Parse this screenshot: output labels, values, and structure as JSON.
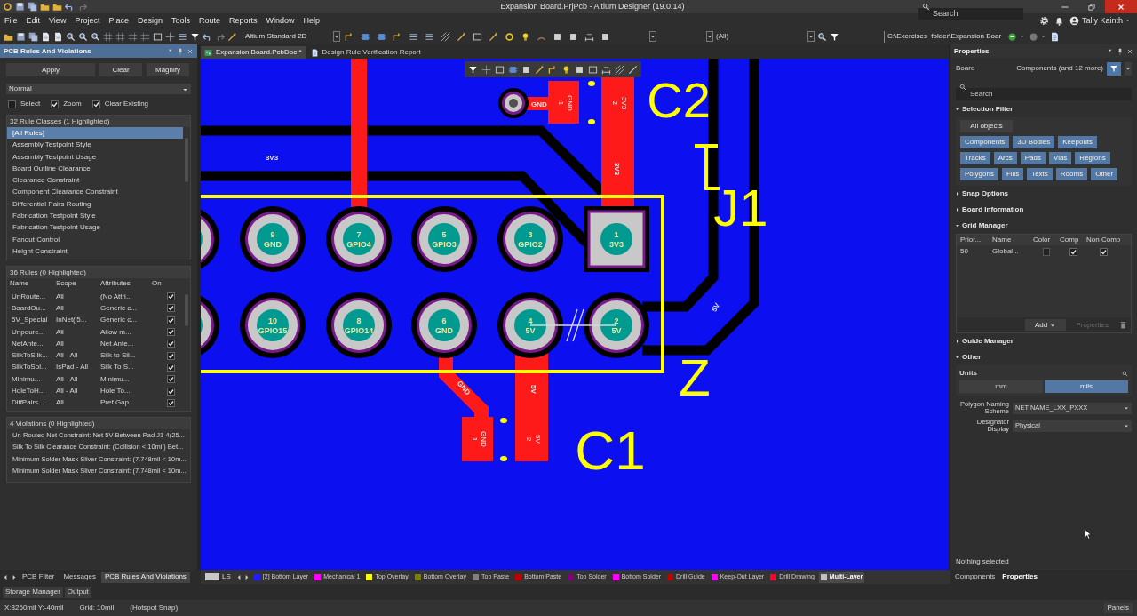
{
  "title_bar": {
    "title": "Expansion Board.PrjPcb - Altium Designer (19.0.14)",
    "search_placeholder": "Search"
  },
  "menu": [
    "File",
    "Edit",
    "View",
    "Project",
    "Place",
    "Design",
    "Tools",
    "Route",
    "Reports",
    "Window",
    "Help"
  ],
  "user": {
    "name": "Tally Kainth"
  },
  "toolbar": {
    "view_mode": "Altium Standard 2D",
    "filter": "(All)",
    "path": "C:\\Exercises  folder\\Expansion Boar"
  },
  "left_panel": {
    "title": "PCB Rules And Violations",
    "buttons": [
      "Apply",
      "Clear",
      "Magnify"
    ],
    "mode": "Normal",
    "options": [
      {
        "label": "Select",
        "checked": false
      },
      {
        "label": "Zoom",
        "checked": true
      },
      {
        "label": "Clear Existing",
        "checked": true
      }
    ],
    "rule_classes": {
      "header": "32 Rule Classes (1 Highlighted)",
      "items": [
        {
          "label": "[All Rules]",
          "selected": true
        },
        {
          "label": "Assembly Testpoint Style",
          "selected": false
        },
        {
          "label": "Assembly Testpoint Usage",
          "selected": false
        },
        {
          "label": "Board Outline Clearance",
          "selected": false
        },
        {
          "label": "Clearance Constraint",
          "selected": false
        },
        {
          "label": "Component Clearance Constraint",
          "selected": false
        },
        {
          "label": "Differential Pairs Routing",
          "selected": false
        },
        {
          "label": "Fabrication Testpoint Style",
          "selected": false
        },
        {
          "label": "Fabrication Testpoint Usage",
          "selected": false
        },
        {
          "label": "Fanout Control",
          "selected": false
        },
        {
          "label": "Height Constraint",
          "selected": false
        }
      ]
    },
    "rules": {
      "header": "36 Rules (0 Highlighted)",
      "columns": [
        "Name",
        "Scope",
        "Attributes",
        "On"
      ],
      "rows": [
        {
          "name": "UnRoute...",
          "scope": "All",
          "attributes": "(No Attri...",
          "on": true
        },
        {
          "name": "BoardOu...",
          "scope": "All",
          "attributes": "Generic c...",
          "on": true
        },
        {
          "name": "5V_Special",
          "scope": "InNet('5...",
          "attributes": "Generic c...",
          "on": true
        },
        {
          "name": "Unpoure...",
          "scope": "All",
          "attributes": "Allow m...",
          "on": true
        },
        {
          "name": "NetAnte...",
          "scope": "All",
          "attributes": "Net Ante...",
          "on": true
        },
        {
          "name": "SilkToSilk...",
          "scope": "All - All",
          "attributes": "Silk to Sil...",
          "on": true
        },
        {
          "name": "SilkToSol...",
          "scope": "IsPad - All",
          "attributes": "Silk To S...",
          "on": true
        },
        {
          "name": "Minimu...",
          "scope": "All - All",
          "attributes": "Minimu...",
          "on": true
        },
        {
          "name": "HoleToH...",
          "scope": "All - All",
          "attributes": "Hole To...",
          "on": true
        },
        {
          "name": "DiffPairs...",
          "scope": "All",
          "attributes": "Pref Gap...",
          "on": true
        }
      ]
    },
    "violations": {
      "header": "4 Violations (0 Highlighted)",
      "items": [
        "Un-Routed Net Constraint: Net 5V Between Pad J1-4(25...",
        "Silk To Silk Clearance Constraint: (Collision < 10mil) Bet...",
        "Minimum Solder Mask Sliver Constraint: (7.748mil < 10m...",
        "Minimum Solder Mask Sliver Constraint: (7.748mil < 10m..."
      ]
    }
  },
  "doc_tabs": [
    {
      "label": "Expansion Board.PcbDoc *",
      "kind": "pcb",
      "selected": true
    },
    {
      "label": "Design Rule Verification Report",
      "kind": "report",
      "selected": false
    }
  ],
  "board": {
    "pad_rows": [
      [
        {
          "kind": "round"
        },
        {
          "kind": "round",
          "number": "9",
          "net": "GND"
        },
        {
          "kind": "round",
          "number": "7",
          "net": "GPIO4"
        },
        {
          "kind": "round",
          "number": "5",
          "net": "GPIO3"
        },
        {
          "kind": "round",
          "number": "3",
          "net": "GPIO2"
        },
        {
          "kind": "square",
          "number": "1",
          "net": "3V3"
        }
      ],
      [
        {
          "kind": "round"
        },
        {
          "kind": "round",
          "number": "10",
          "net": "GPIO15"
        },
        {
          "kind": "round",
          "number": "8",
          "net": "GPIO14"
        },
        {
          "kind": "round",
          "number": "6",
          "net": "GND"
        },
        {
          "kind": "round",
          "number": "4",
          "net": "5V"
        },
        {
          "kind": "round",
          "number": "2",
          "net": "5V"
        }
      ]
    ],
    "smd_pads": [
      {
        "number": "1",
        "net": "GND"
      },
      {
        "number": "2",
        "net": "3V3"
      },
      {
        "number": "1",
        "net": "GND"
      },
      {
        "number": "2",
        "net": "5V"
      }
    ],
    "net_labels": [
      "GND",
      "3V3",
      "3V3",
      "5V",
      "GND",
      "5V"
    ],
    "designators": [
      "C2",
      "J1",
      "Z",
      "C1"
    ]
  },
  "properties": {
    "title": "Properties",
    "object": "Board",
    "filter_summary": "Components (and 12 more)",
    "search_placeholder": "Search",
    "sections": [
      {
        "kind": "selection_filter",
        "label": "Selection Filter",
        "expanded": true
      },
      {
        "label": "Snap Options",
        "expanded": false
      },
      {
        "label": "Board Information",
        "expanded": false
      },
      {
        "kind": "grid_manager",
        "label": "Grid Manager",
        "expanded": true
      },
      {
        "label": "Guide Manager",
        "expanded": false
      },
      {
        "kind": "other",
        "label": "Other",
        "expanded": true
      }
    ],
    "all_objects": "All objects",
    "filters": [
      {
        "label": "Components",
        "on": true
      },
      {
        "label": "3D Bodies",
        "on": true
      },
      {
        "label": "Keepouts",
        "on": true
      },
      {
        "label": "Tracks",
        "on": true
      },
      {
        "label": "Arcs",
        "on": true
      },
      {
        "label": "Pads",
        "on": true
      },
      {
        "label": "Vias",
        "on": true
      },
      {
        "label": "Regions",
        "on": true
      },
      {
        "label": "Polygons",
        "on": true
      },
      {
        "label": "Fills",
        "on": true
      },
      {
        "label": "Texts",
        "on": true
      },
      {
        "label": "Rooms",
        "on": true
      },
      {
        "label": "Other",
        "on": true
      }
    ],
    "grid": {
      "columns": [
        "Prior...",
        "Name",
        "Color",
        "Comp",
        "Non Comp"
      ],
      "rows": [
        {
          "priority": "50",
          "name": "Global...",
          "comp": true,
          "non_comp": true
        }
      ],
      "buttons": [
        {
          "label": "Add",
          "disabled": false
        },
        {
          "label": "Properties",
          "disabled": true
        }
      ]
    },
    "units_label": "Units",
    "units": [
      {
        "label": "mm",
        "selected": false
      },
      {
        "label": "mils",
        "selected": true
      }
    ],
    "fields": [
      {
        "label": "Polygon Naming Scheme",
        "value": "NET NAME_LXX_PXXX"
      },
      {
        "label": "Designator Display",
        "value": "Physical"
      }
    ],
    "footer": "Nothing selected"
  },
  "panel_tabs": [
    {
      "label": "PCB Filter",
      "selected": false
    },
    {
      "label": "Messages",
      "selected": false
    },
    {
      "label": "PCB Rules And Violations",
      "selected": true
    }
  ],
  "layer_set": "LS",
  "layers": [
    {
      "label": "[2] Bottom Layer",
      "color": "#2020ff",
      "selected": false
    },
    {
      "label": "Mechanical 1",
      "color": "#ff00ff",
      "selected": false
    },
    {
      "label": "Top Overlay",
      "color": "#ffff00",
      "selected": false
    },
    {
      "label": "Bottom Overlay",
      "color": "#808000",
      "selected": false
    },
    {
      "label": "Top Paste",
      "color": "#808080",
      "selected": false
    },
    {
      "label": "Bottom Paste",
      "color": "#c00000",
      "selected": false
    },
    {
      "label": "Top Solder",
      "color": "#800080",
      "selected": false
    },
    {
      "label": "Bottom Solder",
      "color": "#ff00ff",
      "selected": false
    },
    {
      "label": "Drill Guide",
      "color": "#c00000",
      "selected": false
    },
    {
      "label": "Keep-Out Layer",
      "color": "#ff00ff",
      "selected": false
    },
    {
      "label": "Drill Drawing",
      "color": "#ff0033",
      "selected": false
    },
    {
      "label": "Multi-Layer",
      "color": "#c0c0c0",
      "selected": true
    }
  ],
  "right_tabs": [
    {
      "label": "Components",
      "selected": false
    },
    {
      "label": "Properties",
      "selected": true
    }
  ],
  "bottom_tabs": [
    "Storage Manager",
    "Output"
  ],
  "status_bar": {
    "coords": "X:3260mil Y:-40mil",
    "grid": "Grid: 10mil",
    "snap": "(Hotspot Snap)",
    "panels_button": "Panels"
  }
}
